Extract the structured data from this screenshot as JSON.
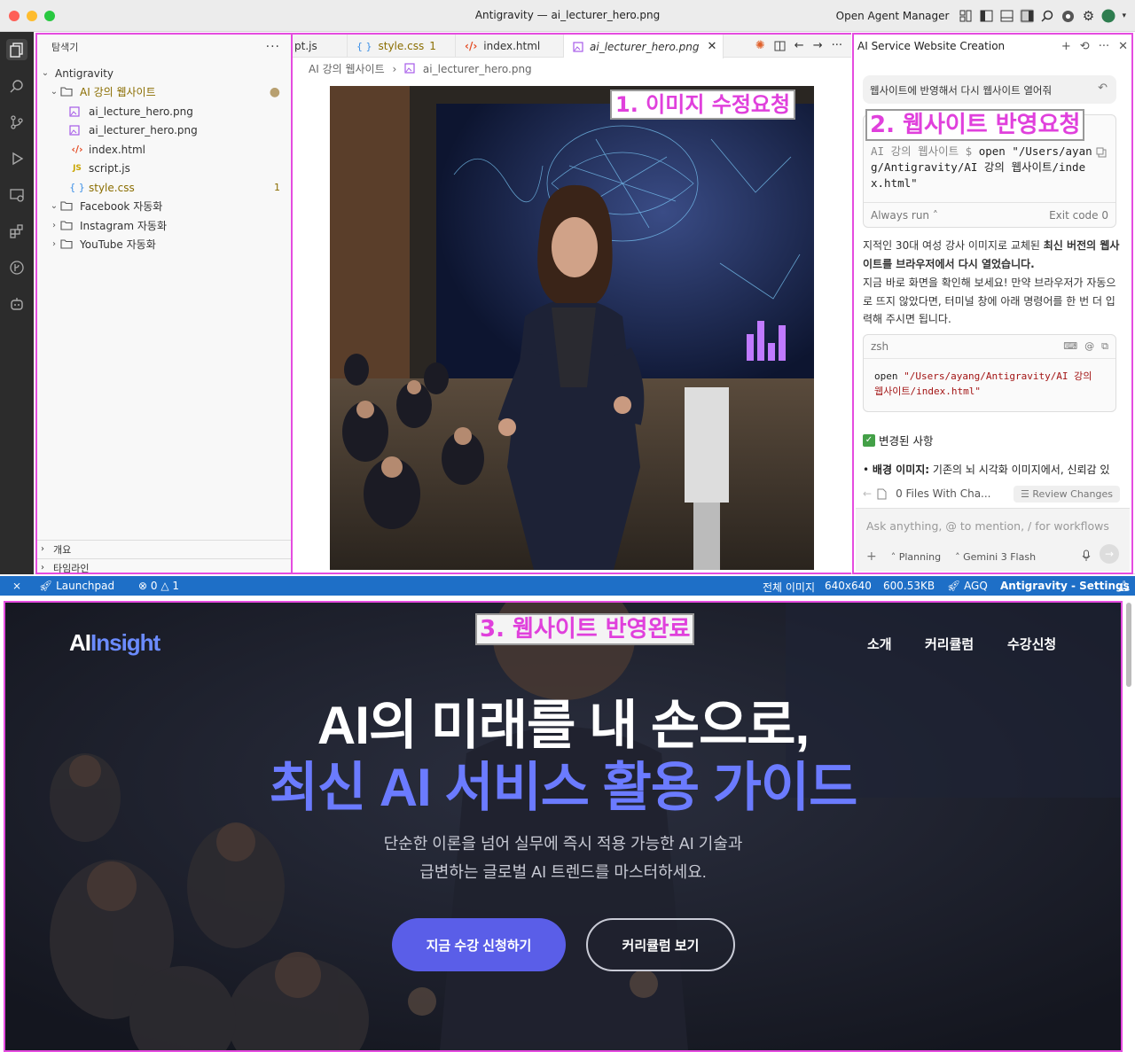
{
  "window": {
    "title": "Antigravity — ai_lecturer_hero.png",
    "open_agent_manager": "Open Agent Manager"
  },
  "explorer": {
    "header": "탐색기",
    "root": "Antigravity",
    "folder_open": "AI 강의 웹사이트",
    "files": [
      {
        "name": "ai_lecture_hero.png",
        "icon": "image-icon"
      },
      {
        "name": "ai_lecturer_hero.png",
        "icon": "image-icon"
      },
      {
        "name": "index.html",
        "icon": "html-icon"
      },
      {
        "name": "script.js",
        "icon": "js-icon"
      },
      {
        "name": "style.css",
        "icon": "css-icon",
        "badge": "1"
      }
    ],
    "folders": [
      "Facebook 자동화",
      "Instagram 자동화",
      "YouTube 자동화"
    ],
    "outline": "개요",
    "timeline": "타임라인"
  },
  "editor": {
    "tabs": [
      {
        "label": "pt.js"
      },
      {
        "label": "style.css",
        "badge": "1"
      },
      {
        "label": "index.html"
      },
      {
        "label": "ai_lecturer_hero.png",
        "active": true
      }
    ],
    "breadcrumb": [
      "AI 강의 웹사이트",
      "ai_lecturer_hero.png"
    ]
  },
  "annotations": {
    "one": "1. 이미지 수정요청",
    "two": "2. 웹사이트 반영요청",
    "three": "3. 웹사이트 반영완료"
  },
  "agent": {
    "title": "AI Service Website Creation",
    "user_message": "웹사이트에 반영해서 다시 웹사이트 열어줘",
    "terminal": {
      "prompt": "AI 강의 웹사이트 $",
      "command": "open \"/Users/ayang/Antigravity/AI 강의 웹사이트/index.html\"",
      "always_run": "Always run",
      "exit_code": "Exit code 0"
    },
    "response_p1_pre": "지적인 30대 여성 강사 이미지로 교체된 ",
    "response_p1_bold": "최신 버전의 웹사이트를 브라우저에서 다시 열었습니다.",
    "response_p2": "지금 바로 화면을 확인해 보세요! 만약 브라우저가 자동으로 뜨지 않았다면, 터미널 창에 아래 명령어를 한 번 더 입력해 주시면 됩니다.",
    "zsh_label": "zsh",
    "zsh_cmd": "open",
    "zsh_path": "\"/Users/ayang/Antigravity/AI 강의 웹사이트/index.html\"",
    "changes_heading": "변경된 사항",
    "changes_item_bold": "배경 이미지:",
    "changes_item_text": " 기존의 뇌 시각화 이미지에서, 신뢰감 있",
    "files_changed": "0 Files With Cha...",
    "review_changes": "Review Changes",
    "input_placeholder": "Ask anything, @ to mention, / for workflows",
    "mode": "Planning",
    "model": "Gemini 3 Flash"
  },
  "statusbar": {
    "launchpad": "Launchpad",
    "errors": "0",
    "warnings": "1",
    "image_label": "전체 이미지",
    "dimensions": "640x640",
    "filesize": "600.53KB",
    "agq": "AGQ",
    "settings": "Antigravity - Settings"
  },
  "website": {
    "logo_ai": "AI",
    "logo_rest": "Insight",
    "nav": [
      "소개",
      "커리큘럼",
      "수강신청"
    ],
    "headline_1": "AI의 미래를 내 손으로,",
    "headline_2": "최신 AI 서비스 활용 가이드",
    "sub_1": "단순한 이론을 넘어 실무에 즉시 적용 가능한 AI 기술과",
    "sub_2": "급변하는 글로벌 AI 트렌드를 마스터하세요.",
    "cta_primary": "지금 수강 신청하기",
    "cta_secondary": "커리큘럼 보기"
  },
  "colors": {
    "accent": "#5a5ee8",
    "annotation": "#e040dc",
    "statusbar": "#1e6fc7"
  }
}
